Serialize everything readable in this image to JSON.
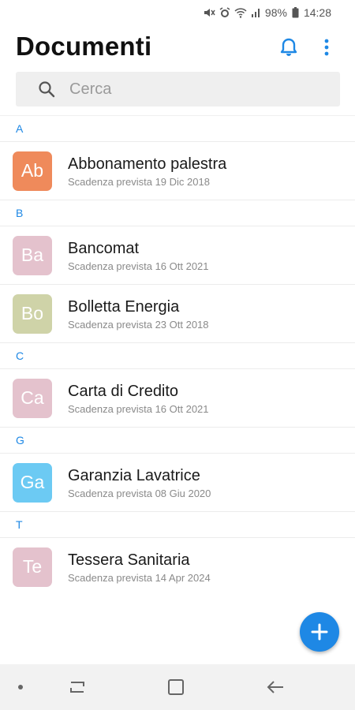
{
  "status_bar": {
    "battery": "98%",
    "time": "14:28",
    "icons": [
      "mute-icon",
      "alarm-icon",
      "wifi-icon",
      "signal-icon",
      "battery-icon"
    ]
  },
  "header": {
    "title": "Documenti",
    "icons": [
      "bell-icon",
      "more-vert-icon"
    ]
  },
  "search": {
    "placeholder": "Cerca"
  },
  "sections": [
    {
      "letter": "A",
      "items": [
        {
          "initials": "Ab",
          "title": "Abbonamento palestra",
          "subtitle": "Scadenza prevista 19 Dic 2018",
          "color": "#ef8a5b"
        }
      ]
    },
    {
      "letter": "B",
      "items": [
        {
          "initials": "Ba",
          "title": "Bancomat",
          "subtitle": "Scadenza prevista 16 Ott 2021",
          "color": "#e4c2cd"
        },
        {
          "initials": "Bo",
          "title": "Bolletta Energia",
          "subtitle": "Scadenza prevista 23 Ott 2018",
          "color": "#cfd3a8"
        }
      ]
    },
    {
      "letter": "C",
      "items": [
        {
          "initials": "Ca",
          "title": "Carta di Credito",
          "subtitle": "Scadenza prevista 16 Ott 2021",
          "color": "#e4c2cd"
        }
      ]
    },
    {
      "letter": "G",
      "items": [
        {
          "initials": "Ga",
          "title": "Garanzia Lavatrice",
          "subtitle": "Scadenza prevista 08 Giu 2020",
          "color": "#6ccaf3"
        }
      ]
    },
    {
      "letter": "T",
      "items": [
        {
          "initials": "Te",
          "title": "Tessera Sanitaria",
          "subtitle": "Scadenza prevista 14 Apr 2024",
          "color": "#e4c2cd"
        }
      ]
    }
  ],
  "fab": {
    "icon": "plus-icon"
  },
  "colors": {
    "accent": "#1e88e5"
  },
  "nav_bar": {
    "icons": [
      "dot-icon",
      "recent-apps-icon",
      "home-icon",
      "back-icon"
    ]
  }
}
